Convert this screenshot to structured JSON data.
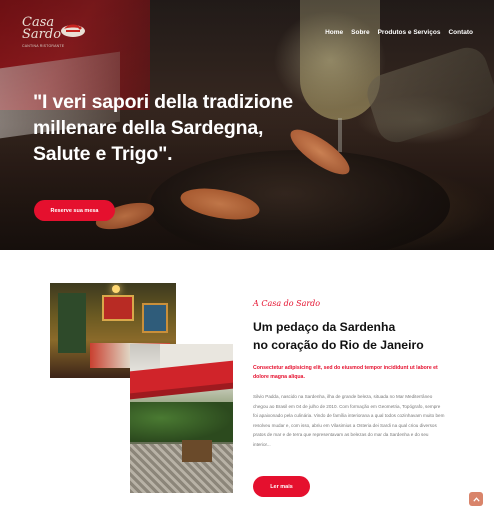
{
  "brand": {
    "logo_line1": "Casa",
    "logo_line2": "Sardo",
    "logo_tagline": "CANTINA RISTORANTE"
  },
  "nav": {
    "items": [
      "Home",
      "Sobre",
      "Produtos e Serviços",
      "Contato"
    ]
  },
  "hero": {
    "title": "\"I veri sapori della tradizione millenare della Sardegna, Salute e Trigo\".",
    "cta_label": "Reserve sua mesa"
  },
  "about": {
    "script_label": "A Casa do Sardo",
    "title_line1": "Um pedaço da Sardenha",
    "title_line2": "no coração do Rio de Janeiro",
    "lead": "Consectetur adipisicing elit, sed do eiusmod tempor incididunt ut labore et dolore magna aliqua.",
    "body": "Silvio Padda, nascido na Sardenha, ilha de grande beleza, situada no Mar Mediterrâneo chegou ao Brasil em 04 de julho de 2010. Com formação em Geometria, Topógrafo, sempre foi apaixonado pela culinária. Vindo de família interiorana a qual todos cozinhavam muito bem resolveu mudar e, com isso, abriu em Vilasimius a Osteria dei Sardi na qual criou diversos pratos de mar e de terra que representavam as belezas do mar da Sardenha e do seu interior...",
    "cta_label": "Ler mais"
  },
  "colors": {
    "accent": "#e5102e",
    "scroll_button": "#d9846a"
  },
  "icons": {
    "logo_emblem": "lobster-plate-emblem",
    "scroll_top": "chevron-up-icon"
  }
}
